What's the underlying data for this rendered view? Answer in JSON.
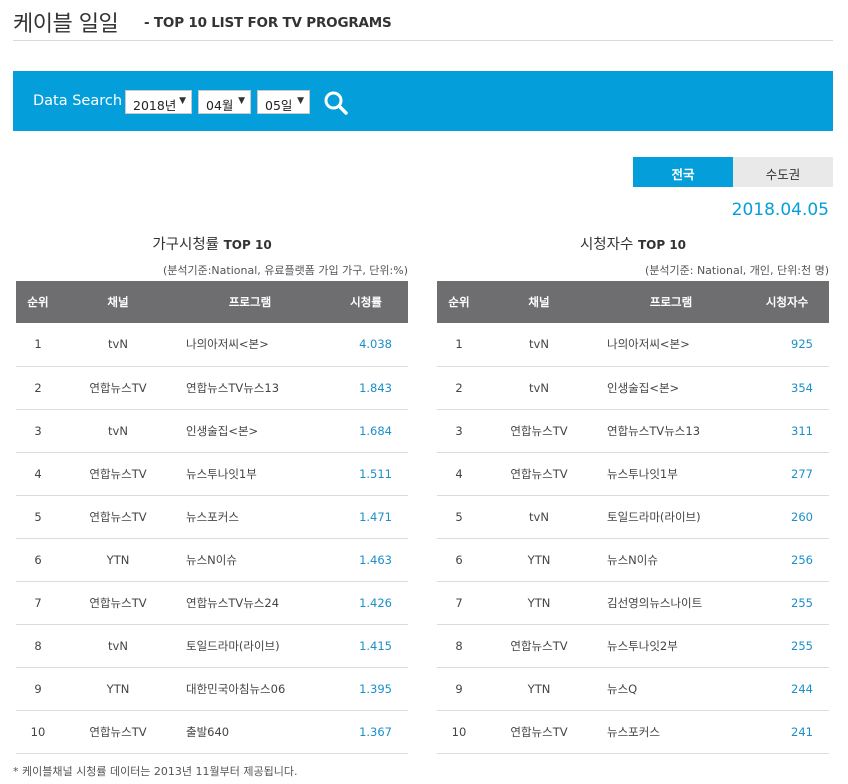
{
  "header": {
    "title_main": "케이블 일일",
    "title_sub": "- TOP 10 LIST FOR TV PROGRAMS"
  },
  "search": {
    "label": "Data Search",
    "year": "2018년",
    "month": "04월",
    "day": "05일"
  },
  "tabs": {
    "national": "전국",
    "capital": "수도권"
  },
  "date": "2018.04.05",
  "left_panel": {
    "title_big": "가구시청률",
    "title_small": "TOP 10",
    "note": "(분석기준:National, 유료플랫폼 가입 가구, 단위:%)",
    "columns": [
      "순위",
      "채널",
      "프로그램",
      "시청률"
    ],
    "rows": [
      [
        "1",
        "tvN",
        "나의아저씨<본>",
        "4.038"
      ],
      [
        "2",
        "연합뉴스TV",
        "연합뉴스TV뉴스13",
        "1.843"
      ],
      [
        "3",
        "tvN",
        "인생술집<본>",
        "1.684"
      ],
      [
        "4",
        "연합뉴스TV",
        "뉴스투나잇1부",
        "1.511"
      ],
      [
        "5",
        "연합뉴스TV",
        "뉴스포커스",
        "1.471"
      ],
      [
        "6",
        "YTN",
        "뉴스N이슈",
        "1.463"
      ],
      [
        "7",
        "연합뉴스TV",
        "연합뉴스TV뉴스24",
        "1.426"
      ],
      [
        "8",
        "tvN",
        "토일드라마(라이브)",
        "1.415"
      ],
      [
        "9",
        "YTN",
        "대한민국아침뉴스06",
        "1.395"
      ],
      [
        "10",
        "연합뉴스TV",
        "출발640",
        "1.367"
      ]
    ]
  },
  "right_panel": {
    "title_big": "시청자수",
    "title_small": "TOP 10",
    "note": "(분석기준: National, 개인, 단위:천 명)",
    "columns": [
      "순위",
      "채널",
      "프로그램",
      "시청자수"
    ],
    "rows": [
      [
        "1",
        "tvN",
        "나의아저씨<본>",
        "925"
      ],
      [
        "2",
        "tvN",
        "인생술집<본>",
        "354"
      ],
      [
        "3",
        "연합뉴스TV",
        "연합뉴스TV뉴스13",
        "311"
      ],
      [
        "4",
        "연합뉴스TV",
        "뉴스투나잇1부",
        "277"
      ],
      [
        "5",
        "tvN",
        "토일드라마(라이브)",
        "260"
      ],
      [
        "6",
        "YTN",
        "뉴스N이슈",
        "256"
      ],
      [
        "7",
        "YTN",
        "김선영의뉴스나이트",
        "255"
      ],
      [
        "8",
        "연합뉴스TV",
        "뉴스투나잇2부",
        "255"
      ],
      [
        "9",
        "YTN",
        "뉴스Q",
        "244"
      ],
      [
        "10",
        "연합뉴스TV",
        "뉴스포커스",
        "241"
      ]
    ]
  },
  "footnote": "* 케이블채널 시청률 데이터는 2013년 11월부터 제공됩니다.",
  "colors": {
    "accent": "#049fdb",
    "table_header": "#6e6e70",
    "value_text": "#1a8fc9"
  }
}
